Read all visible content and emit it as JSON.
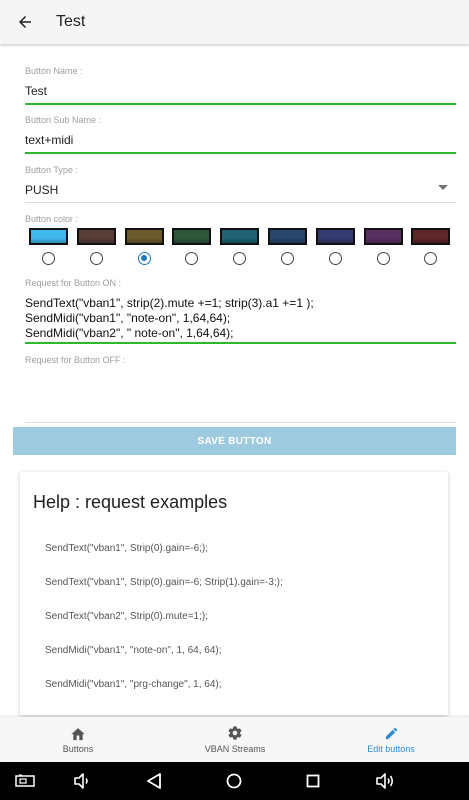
{
  "appbar": {
    "title": "Test"
  },
  "form": {
    "button_name": {
      "label": "Button Name :",
      "value": "Test"
    },
    "button_sub_name": {
      "label": "Button Sub Name :",
      "value": "text+midi"
    },
    "button_type": {
      "label": "Button Type :",
      "value": "PUSH"
    },
    "button_color": {
      "label": "Button color :",
      "swatches": [
        "#3fb8ee",
        "#5a3e36",
        "#6b5a2a",
        "#2e5638",
        "#1e6274",
        "#26466c",
        "#333c70",
        "#5a3062",
        "#5e2628"
      ],
      "selected_index": 2
    },
    "request_on": {
      "label": "Request for Button ON :",
      "lines": [
        "SendText(\"vban1\", strip(2).mute +=1; strip(3).a1 +=1 );",
        "SendMidi(\"vban1\", \"note-on\", 1,64,64);",
        "SendMidi(\"vban2\", \" note-on\", 1,64,64);"
      ]
    },
    "request_off": {
      "label": "Request for Button OFF :",
      "value": ""
    },
    "save_button": "SAVE BUTTON"
  },
  "help": {
    "title": "Help : request examples",
    "examples": [
      "SendText(\"vban1\", Strip(0).gain=-6;);",
      "SendText(\"vban1\", Strip(0).gain=-6; Strip(1).gain=-3;);",
      "SendText(\"vban2\", Strip(0).mute=1;);",
      "SendMidi(\"vban1\", \"note-on\", 1, 64, 64);",
      "SendMidi(\"vban1\", \"prg-change\", 1, 64);"
    ]
  },
  "bottom_nav": {
    "items": [
      {
        "label": "Buttons",
        "icon": "home-icon",
        "active": false
      },
      {
        "label": "VBAN Streams",
        "icon": "gear-icon",
        "active": false
      },
      {
        "label": "Edit buttons",
        "icon": "pencil-icon",
        "active": true
      }
    ],
    "active_color": "#2a8ad0"
  },
  "system_bar": {
    "icons": [
      "screenshot-icon",
      "volume-down-icon",
      "back-triangle-icon",
      "home-circle-icon",
      "recents-square-icon",
      "volume-up-icon"
    ]
  }
}
